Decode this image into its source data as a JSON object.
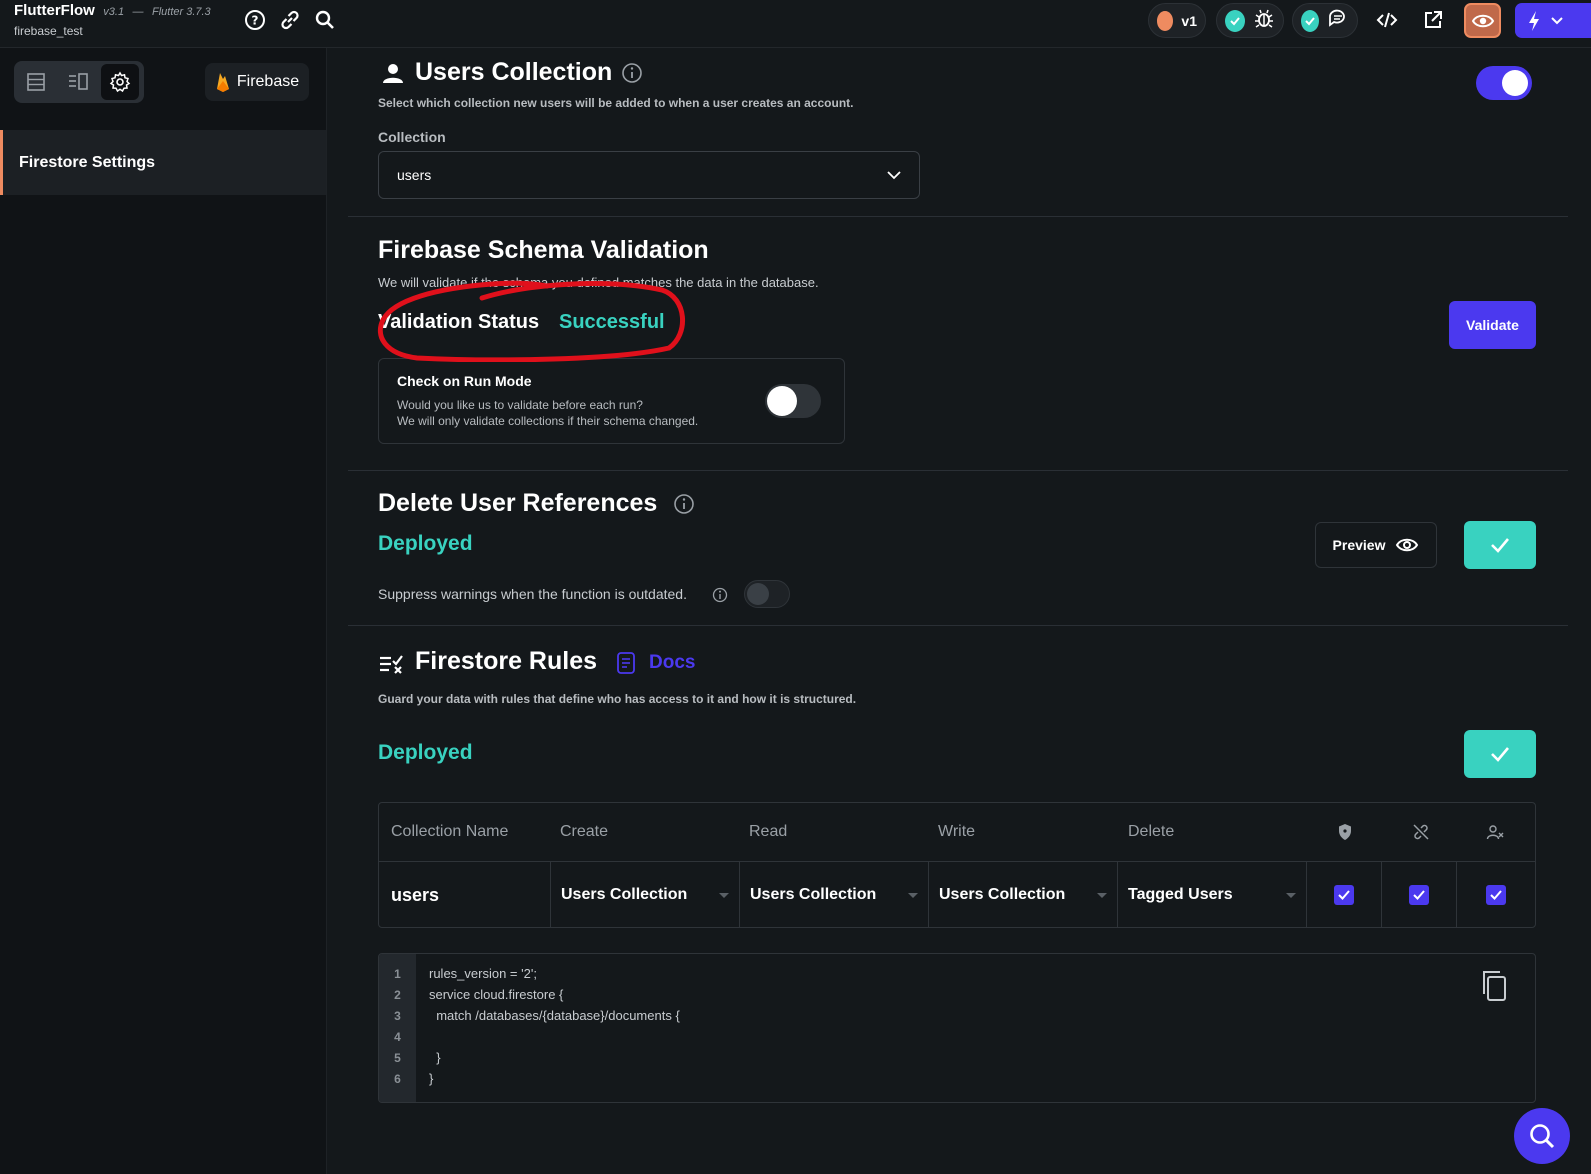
{
  "app": {
    "name": "FlutterFlow",
    "version": "v3.1",
    "flutter_version": "Flutter 3.7.3",
    "project": "firebase_test"
  },
  "topbar": {
    "version_label": "v1"
  },
  "sidebar": {
    "firebase_label": "Firebase",
    "items": [
      {
        "label": "Firestore Settings",
        "active": true
      }
    ]
  },
  "users_collection": {
    "title": "Users Collection",
    "description": "Select which collection new users will be added to when a user creates an account.",
    "enabled": true,
    "collection_label": "Collection",
    "collection_value": "users"
  },
  "schema_validation": {
    "title": "Firebase Schema Validation",
    "description": "We will validate if the schema you defined matches the data in the database.",
    "status_label": "Validation Status",
    "status_value": "Successful",
    "validate_button": "Validate",
    "check_run_mode": {
      "title": "Check on Run Mode",
      "line1": "Would you like us to validate before each run?",
      "line2": "We will only validate collections if their schema changed.",
      "enabled": false
    }
  },
  "delete_user_refs": {
    "title": "Delete User References",
    "status": "Deployed",
    "preview_button": "Preview",
    "suppress_label": "Suppress warnings when the function is outdated.",
    "suppress_enabled": false
  },
  "firestore_rules": {
    "title": "Firestore Rules",
    "docs_link": "Docs",
    "description": "Guard your data with rules that define who has access to it and how it is structured.",
    "status": "Deployed",
    "table": {
      "headers": [
        "Collection Name",
        "Create",
        "Read",
        "Write",
        "Delete"
      ],
      "rows": [
        {
          "name": "users",
          "create": "Users Collection",
          "read": "Users Collection",
          "write": "Users Collection",
          "delete": "Tagged Users",
          "flags": [
            true,
            true,
            true
          ]
        }
      ]
    },
    "code_lines": [
      "rules_version = '2';",
      "service cloud.firestore {",
      "  match /databases/{database}/documents {",
      "",
      "  }",
      "}"
    ],
    "line_numbers": [
      "1",
      "2",
      "3",
      "4",
      "5",
      "6"
    ]
  },
  "colors": {
    "accent": "#4b39ef",
    "success": "#39d2c0",
    "annotation": "#e0101b"
  }
}
